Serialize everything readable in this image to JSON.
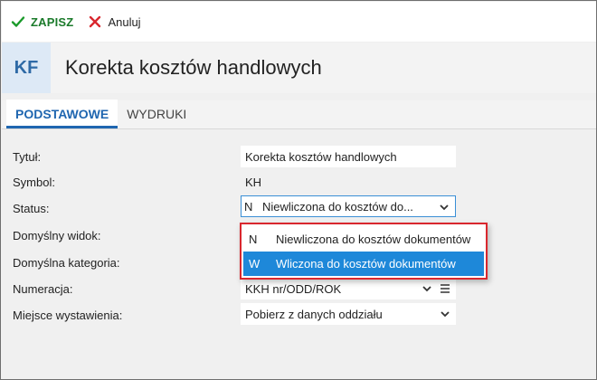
{
  "toolbar": {
    "save_label": "ZAPISZ",
    "cancel_label": "Anuluj",
    "save_color": "#1a7a2a",
    "cancel_color": "#d9272e"
  },
  "header": {
    "badge": "KF",
    "title": "Korekta kosztów handlowych"
  },
  "tabs": [
    {
      "label": "PODSTAWOWE",
      "active": true
    },
    {
      "label": "WYDRUKI",
      "active": false
    }
  ],
  "form": {
    "title": {
      "label": "Tytuł:",
      "value": "Korekta kosztów handlowych"
    },
    "symbol": {
      "label": "Symbol:",
      "value": "KH"
    },
    "status": {
      "label": "Status:",
      "code": "N",
      "value": "Niewliczona do kosztów do..."
    },
    "default_view": {
      "label": "Domyślny widok:"
    },
    "default_category": {
      "label": "Domyślna kategoria:"
    },
    "numbering": {
      "label": "Numeracja:",
      "value": "KKH nr/ODD/ROK"
    },
    "issue_place": {
      "label": "Miejsce wystawienia:",
      "value": "Pobierz z danych oddziału"
    }
  },
  "status_dropdown": {
    "options": [
      {
        "code": "N",
        "label": "Niewliczona do kosztów dokumentów",
        "selected": false
      },
      {
        "code": "W",
        "label": "Wliczona do kosztów dokumentów",
        "selected": true
      }
    ],
    "highlight_color": "#1e88d9",
    "border_color": "#d9272e"
  },
  "accent_color": "#1f66b0"
}
